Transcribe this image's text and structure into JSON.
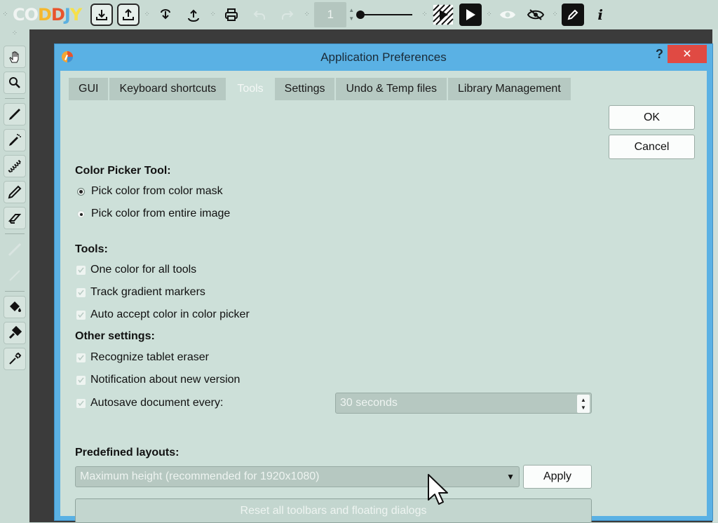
{
  "app": {
    "logo_text": "CODDJY"
  },
  "toolbar": {
    "page_number": "1",
    "icons": [
      "import-icon",
      "export-icon",
      "download-cloud-icon",
      "upload-cloud-icon",
      "print-icon",
      "undo-icon",
      "redo-icon",
      "onion-skin-icon",
      "play-icon",
      "eye-icon",
      "eye-hidden-icon",
      "pencil-edit-icon",
      "info-icon"
    ]
  },
  "dialog": {
    "title": "Application Preferences",
    "help_label": "?",
    "close_label": "✕",
    "tabs": [
      {
        "label": "GUI"
      },
      {
        "label": "Keyboard shortcuts"
      },
      {
        "label": "Tools"
      },
      {
        "label": "Settings"
      },
      {
        "label": "Undo & Temp files"
      },
      {
        "label": "Library Management"
      }
    ],
    "ok_label": "OK",
    "cancel_label": "Cancel",
    "color_picker": {
      "heading": "Color Picker Tool:",
      "options": [
        "Pick color from color mask",
        "Pick color from entire image"
      ]
    },
    "tools": {
      "heading": "Tools:",
      "options": [
        "One color for all tools",
        "Track gradient markers",
        "Auto accept color in color picker"
      ]
    },
    "other": {
      "heading": "Other settings:",
      "options": [
        "Recognize tablet eraser",
        "Notification about new version",
        "Autosave document every:"
      ],
      "autosave_value": "30 seconds"
    },
    "layouts": {
      "heading": "Predefined layouts:",
      "selected": "Maximum height (recommended for 1920x1080)",
      "apply_label": "Apply",
      "reset_label": "Reset all toolbars and floating dialogs"
    }
  }
}
